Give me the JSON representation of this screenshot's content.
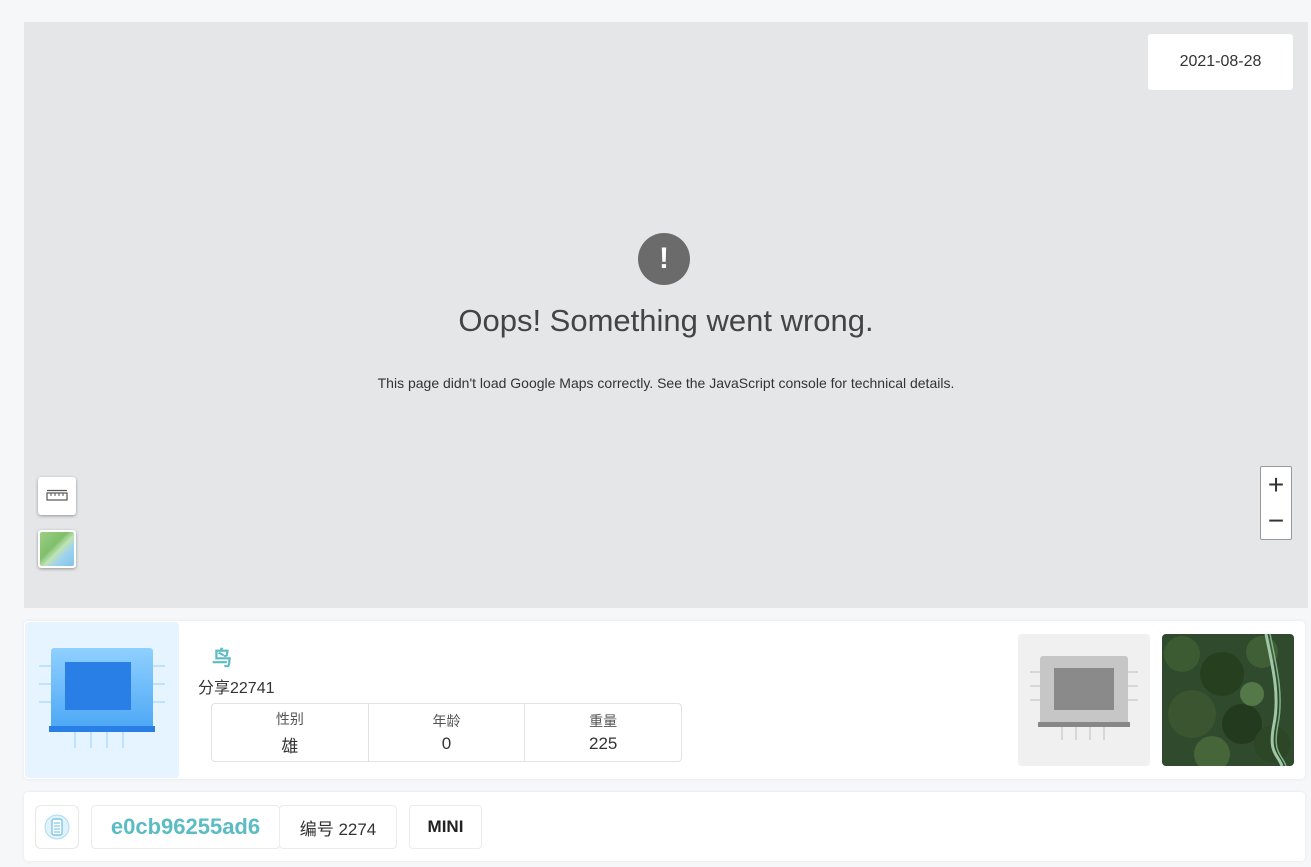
{
  "map": {
    "date": "2021-08-28",
    "error_title": "Oops! Something went wrong.",
    "error_message": "This page didn't load Google Maps correctly. See the JavaScript console for technical details.",
    "zoom_in": "+",
    "zoom_out": "−"
  },
  "bird": {
    "name": "鸟",
    "share": "分享22741",
    "stats": [
      {
        "label": "性别",
        "value": "雄"
      },
      {
        "label": "年龄",
        "value": "0"
      },
      {
        "label": "重量",
        "value": "225"
      }
    ]
  },
  "footer": {
    "device_id": "e0cb96255ad6",
    "number": "编号 2274",
    "model": "MINI"
  },
  "colors": {
    "accent": "#5bbcc4",
    "map_bg": "#e5e6e8",
    "chip_blue": "#3a8ff0"
  }
}
